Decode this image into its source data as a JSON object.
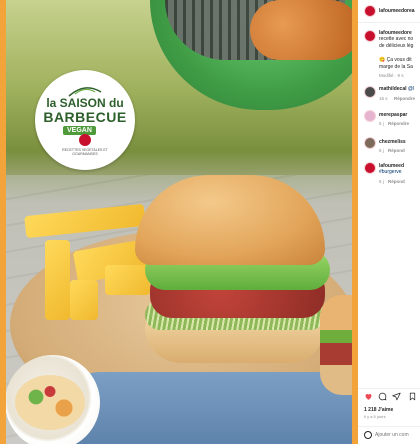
{
  "post": {
    "username": "lafoumeedorea",
    "caption_user": "lafoumeedore",
    "caption_lines": [
      "recette avec no",
      "de délicieux lég",
      "",
      "😋 Ça vous dit",
      "marge de la Sa"
    ],
    "caption_time": "Modifié · 9 s"
  },
  "logo": {
    "line1": "la SAISON du",
    "line2": "BARBECUE",
    "badge": "VEGAN",
    "subtitle": "RECETTES VEGETALES ET GOURMANDES"
  },
  "comments": [
    {
      "user": "mathildecal",
      "text": "@l",
      "time": "16 s",
      "reply": "Répondre"
    },
    {
      "user": "merepaspar",
      "text": "",
      "time": "5 j",
      "reply": "Répondre"
    },
    {
      "user": "chezmeliss",
      "text": "",
      "time": "5 j",
      "reply": "Répond"
    },
    {
      "user": "lafoumeed",
      "text": "#burgerve",
      "time": "5 j",
      "reply": "Répond"
    }
  ],
  "footer": {
    "likes": "1 218 J'aime",
    "date": "Il y a 5 jours",
    "comment_placeholder": "Ajouter un com"
  },
  "colors": {
    "brand": "#c8102e",
    "frame": "#f2a33a",
    "link": "#00376b"
  }
}
